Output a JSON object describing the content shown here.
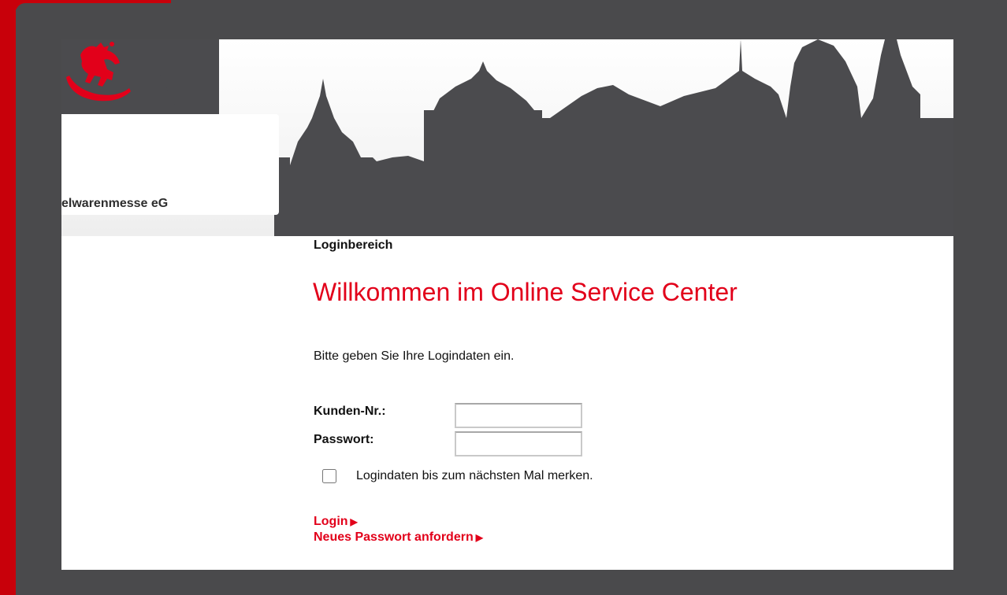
{
  "brand": {
    "logo_text": "elwarenmesse eG",
    "colors": {
      "accent_red": "#e2001a",
      "frame_gray": "#4a4a4c",
      "skyline_gray": "#4b4b4e"
    }
  },
  "login": {
    "section_label": "Loginbereich",
    "title": "Willkommen im Online Service Center",
    "intro": "Bitte geben Sie Ihre Logindaten ein.",
    "customer_label": "Kunden-Nr.:",
    "customer_value": "",
    "password_label": "Passwort:",
    "password_value": "",
    "remember_label": "Logindaten bis zum nächsten Mal merken.",
    "remember_checked": false,
    "login_link": "Login",
    "new_password_link": "Neues Passwort anfordern",
    "link_arrow_icon": "▶"
  }
}
